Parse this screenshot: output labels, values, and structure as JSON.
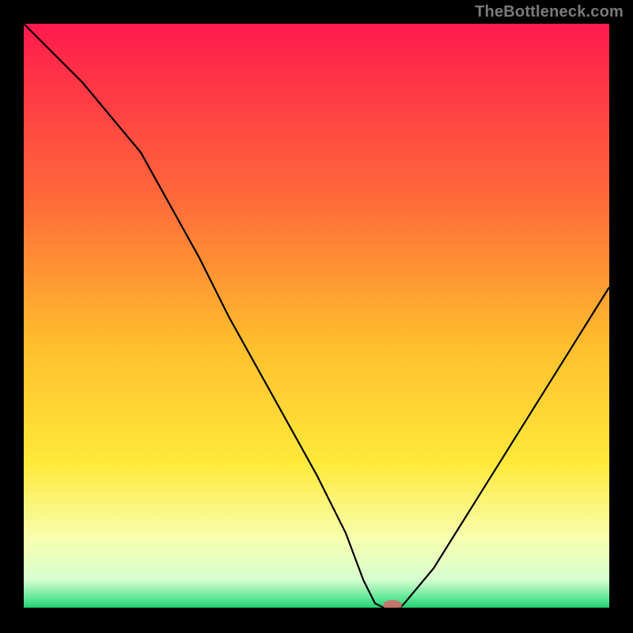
{
  "watermark": "TheBottleneck.com",
  "colors": {
    "frame": "#000000",
    "curve": "#000000",
    "marker": "#d06a6a",
    "gradient_stops": [
      {
        "offset": 0.0,
        "color": "#ff1a4d"
      },
      {
        "offset": 0.3,
        "color": "#ff6a3a"
      },
      {
        "offset": 0.55,
        "color": "#ffbf2d"
      },
      {
        "offset": 0.75,
        "color": "#ffe93a"
      },
      {
        "offset": 0.88,
        "color": "#f8ffb0"
      },
      {
        "offset": 0.95,
        "color": "#d7ffcf"
      },
      {
        "offset": 0.985,
        "color": "#4fe38f"
      },
      {
        "offset": 1.0,
        "color": "#19c96a"
      }
    ]
  },
  "chart_data": {
    "type": "line",
    "title": "",
    "xlabel": "",
    "ylabel": "",
    "xlim": [
      0,
      100
    ],
    "ylim": [
      0,
      100
    ],
    "grid": false,
    "legend": false,
    "series": [
      {
        "name": "curve",
        "x": [
          0,
          5,
          10,
          15,
          20,
          25,
          30,
          35,
          40,
          45,
          50,
          55,
          58,
          60,
          62,
          64,
          65,
          70,
          75,
          80,
          85,
          90,
          95,
          100
        ],
        "y": [
          100,
          95,
          90,
          84,
          78,
          69,
          60,
          50,
          41,
          32,
          23,
          13,
          5,
          1,
          0,
          0,
          1,
          7,
          15,
          23,
          31,
          39,
          47,
          55
        ]
      }
    ],
    "marker": {
      "x": 63,
      "y": 0.7,
      "rx": 1.6,
      "ry": 0.9
    }
  }
}
